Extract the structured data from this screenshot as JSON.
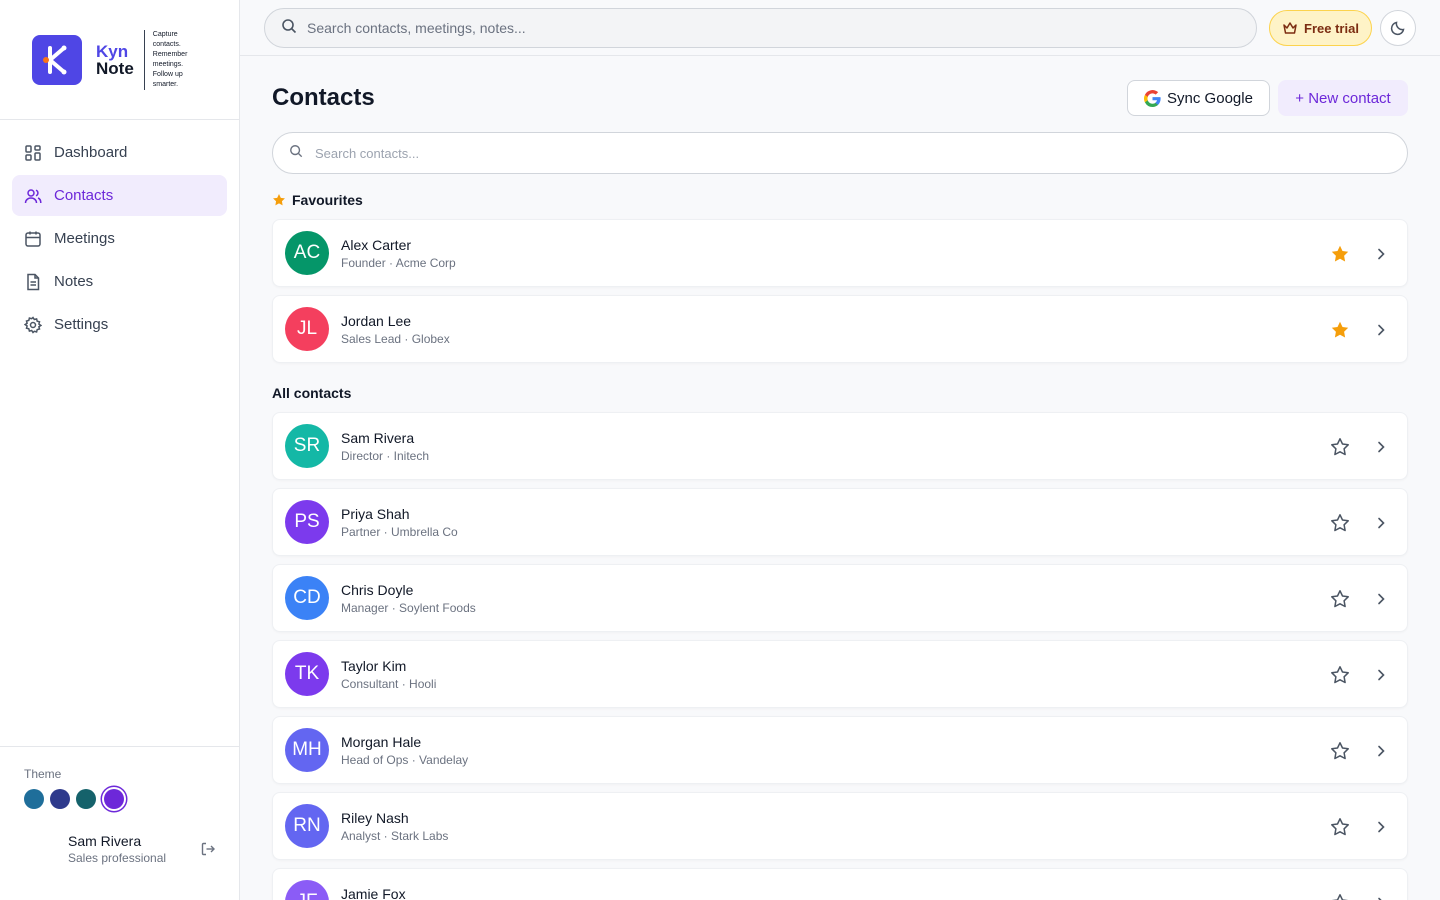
{
  "brand": {
    "name_part1": "Kyn",
    "name_part2": "Note",
    "tagline_line1": "Capture contacts.",
    "tagline_line2": "Remember meetings.",
    "tagline_line3": "Follow up smarter."
  },
  "nav": {
    "items": [
      {
        "label": "Dashboard",
        "icon": "dashboard-icon",
        "active": false
      },
      {
        "label": "Contacts",
        "icon": "users-icon",
        "active": true
      },
      {
        "label": "Meetings",
        "icon": "calendar-icon",
        "active": false
      },
      {
        "label": "Notes",
        "icon": "document-icon",
        "active": false
      },
      {
        "label": "Settings",
        "icon": "gear-icon",
        "active": false
      }
    ]
  },
  "theme": {
    "label": "Theme",
    "swatches": [
      "#1f6e9a",
      "#2e3a8c",
      "#15626b",
      "#6d28d9"
    ],
    "selected_index": 3
  },
  "user": {
    "name": "Sam Rivera",
    "role": "Sales professional"
  },
  "topbar": {
    "search_placeholder": "Search contacts, meetings, notes...",
    "trial_label": "Free trial"
  },
  "page": {
    "title": "Contacts",
    "sync_label": "Sync Google",
    "new_label": "+ New contact",
    "search_placeholder": "Search contacts..."
  },
  "sections": {
    "favourites": "Favourites",
    "all": "All contacts"
  },
  "colors": {
    "accent": "#6d28d9",
    "star_filled": "#f59e0b"
  },
  "favourites": [
    {
      "initials": "AC",
      "name": "Alex Carter",
      "subtitle": "Founder · Acme Corp",
      "color": "#059669",
      "starred": true
    },
    {
      "initials": "JL",
      "name": "Jordan Lee",
      "subtitle": "Sales Lead · Globex",
      "color": "#f43f5e",
      "starred": true
    }
  ],
  "contacts": [
    {
      "initials": "SR",
      "name": "Sam Rivera",
      "subtitle": "Director · Initech",
      "color": "#14b8a6",
      "starred": false
    },
    {
      "initials": "PS",
      "name": "Priya Shah",
      "subtitle": "Partner · Umbrella Co",
      "color": "#7c3aed",
      "starred": false
    },
    {
      "initials": "CD",
      "name": "Chris Doyle",
      "subtitle": "Manager · Soylent Foods",
      "color": "#3b82f6",
      "starred": false
    },
    {
      "initials": "TK",
      "name": "Taylor Kim",
      "subtitle": "Consultant · Hooli",
      "color": "#7c3aed",
      "starred": false
    },
    {
      "initials": "MH",
      "name": "Morgan Hale",
      "subtitle": "Head of Ops · Vandelay",
      "color": "#6366f1",
      "starred": false
    },
    {
      "initials": "RN",
      "name": "Riley Nash",
      "subtitle": "Analyst · Stark Labs",
      "color": "#6366f1",
      "starred": false
    },
    {
      "initials": "JF",
      "name": "Jamie Fox",
      "subtitle": "",
      "color": "#8b5cf6",
      "starred": false
    }
  ]
}
